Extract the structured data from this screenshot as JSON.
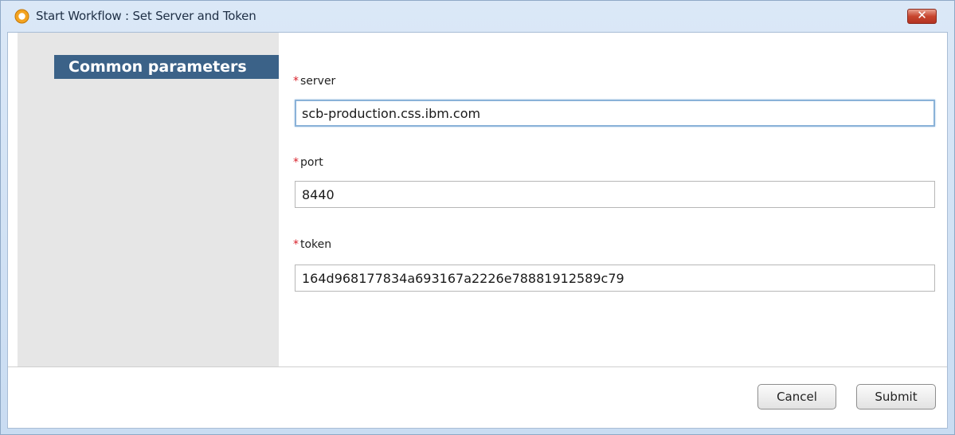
{
  "window": {
    "title": "Start Workflow : Set Server and Token",
    "close_label": "✕"
  },
  "sidebar": {
    "header": "Common parameters"
  },
  "form": {
    "required_marker": "*",
    "fields": [
      {
        "label": "server",
        "value": "scb-production.css.ibm.com",
        "focused": true
      },
      {
        "label": "port",
        "value": "8440",
        "focused": false
      },
      {
        "label": "token",
        "value": "164d968177834a693167a2226e78881912589c79",
        "focused": false
      }
    ]
  },
  "footer": {
    "cancel_label": "Cancel",
    "submit_label": "Submit"
  },
  "colors": {
    "sidebar_header_bg": "#3b6288",
    "required_marker": "#d8202a",
    "close_button": "#c7452e"
  },
  "icons": {
    "app": "app-icon",
    "close": "close-icon"
  }
}
